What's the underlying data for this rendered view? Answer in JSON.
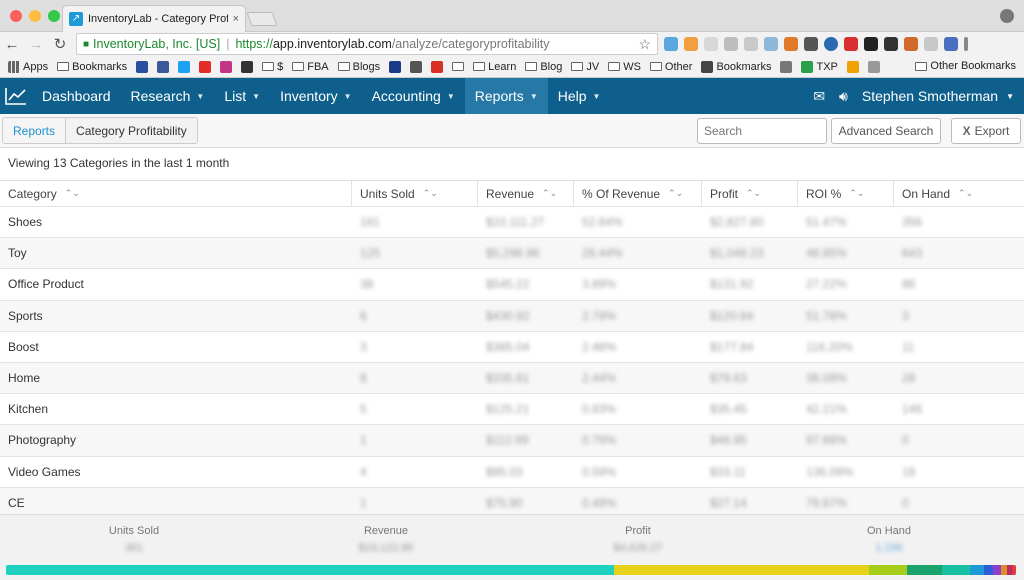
{
  "browser": {
    "tab_title": "InventoryLab - Category Profit",
    "tab_close": "×",
    "address": {
      "org": "InventoryLab, Inc. [US]",
      "scheme": "https://",
      "host": "app.inventorylab.com",
      "path": "/analyze/categoryprofitability"
    }
  },
  "bookmarks": [
    {
      "label": "Apps",
      "icon": "apps-grid-icon"
    },
    {
      "label": "Bookmarks",
      "icon": "folder-icon"
    },
    {
      "label": "",
      "icon": "m-icon"
    },
    {
      "label": "",
      "icon": "facebook-icon"
    },
    {
      "label": "",
      "icon": "twitter-icon"
    },
    {
      "label": "",
      "icon": "youtube-icon"
    },
    {
      "label": "",
      "icon": "instagram-icon"
    },
    {
      "label": "",
      "icon": "bag-icon"
    },
    {
      "label": "$",
      "icon": "folder-icon"
    },
    {
      "label": "FBA",
      "icon": "folder-icon"
    },
    {
      "label": "Blogs",
      "icon": "folder-icon"
    },
    {
      "label": "",
      "icon": "badge-icon"
    },
    {
      "label": "",
      "icon": "apple-icon"
    },
    {
      "label": "",
      "icon": "gmail-icon"
    },
    {
      "label": "",
      "icon": "folder-icon"
    },
    {
      "label": "Learn",
      "icon": "folder-icon"
    },
    {
      "label": "Blog",
      "icon": "folder-icon"
    },
    {
      "label": "JV",
      "icon": "folder-icon"
    },
    {
      "label": "WS",
      "icon": "folder-icon"
    },
    {
      "label": "Other",
      "icon": "folder-icon"
    },
    {
      "label": "Bookmarks",
      "icon": "star-icon"
    },
    {
      "label": "",
      "icon": "gear-icon"
    },
    {
      "label": "TXP",
      "icon": "drive-icon"
    },
    {
      "label": "",
      "icon": "bars-icon"
    },
    {
      "label": "",
      "icon": "seller-icon"
    }
  ],
  "other_bookmarks": "Other Bookmarks",
  "nav": {
    "items": [
      {
        "label": "Dashboard",
        "caret": false
      },
      {
        "label": "Research",
        "caret": true
      },
      {
        "label": "List",
        "caret": true
      },
      {
        "label": "Inventory",
        "caret": true
      },
      {
        "label": "Accounting",
        "caret": true
      },
      {
        "label": "Reports",
        "caret": true,
        "active": true
      },
      {
        "label": "Help",
        "caret": true
      }
    ],
    "user": "Stephen Smotherman"
  },
  "breadcrumb": {
    "root": "Reports",
    "current": "Category Profitability"
  },
  "search_placeholder": "Search",
  "advanced_search": "Advanced Search",
  "export": "Export",
  "viewing_text": "Viewing 13 Categories in the last 1 month",
  "table": {
    "columns": [
      "Category",
      "Units Sold",
      "Revenue",
      "% Of Revenue",
      "Profit",
      "ROI %",
      "On Hand"
    ],
    "rows": [
      [
        "Shoes",
        "161",
        "$10,111.27",
        "52.84%",
        "$2,827.80",
        "51.47%",
        "356"
      ],
      [
        "Toy",
        "125",
        "$5,298.96",
        "28.44%",
        "$1,048.23",
        "48.85%",
        "643"
      ],
      [
        "Office Product",
        "38",
        "$545.22",
        "3.89%",
        "$131.92",
        "27.22%",
        "86"
      ],
      [
        "Sports",
        "6",
        "$430.92",
        "2.79%",
        "$120.84",
        "51.78%",
        "3"
      ],
      [
        "Boost",
        "3",
        "$385.04",
        "2.48%",
        "$177.84",
        "116.20%",
        "11"
      ],
      [
        "Home",
        "8",
        "$335.81",
        "2.44%",
        "$79.63",
        "38.09%",
        "28"
      ],
      [
        "Kitchen",
        "5",
        "$125.21",
        "0.83%",
        "$35.45",
        "42.21%",
        "146"
      ],
      [
        "Photography",
        "1",
        "$112.99",
        "0.79%",
        "$48.95",
        "97.88%",
        "0"
      ],
      [
        "Video Games",
        "4",
        "$95.03",
        "0.59%",
        "$33.11",
        "136.09%",
        "18"
      ],
      [
        "CE",
        "1",
        "$75.90",
        "0.49%",
        "$27.14",
        "79.87%",
        "0"
      ]
    ]
  },
  "totals": {
    "units_label": "Units Sold",
    "units_value": "361",
    "revenue_label": "Revenue",
    "revenue_value": "$19,122.86",
    "profit_label": "Profit",
    "profit_value": "$4,626.27",
    "onhand_label": "On Hand",
    "onhand_value": "1,196"
  },
  "revenue_bar": [
    {
      "share": 0.607,
      "color": "#1ed1c1"
    },
    {
      "share": 0.255,
      "color": "#e7d21a"
    },
    {
      "share": 0.038,
      "color": "#a8cc1a"
    },
    {
      "share": 0.035,
      "color": "#1aa36a"
    },
    {
      "share": 0.028,
      "color": "#16c0a0"
    },
    {
      "share": 0.014,
      "color": "#1e9ad6"
    },
    {
      "share": 0.009,
      "color": "#2f5fd6"
    },
    {
      "share": 0.008,
      "color": "#8d3fc9"
    },
    {
      "share": 0.006,
      "color": "#e08a2a"
    },
    {
      "share": 0.005,
      "color": "#b62d5f"
    },
    {
      "share": 0.004,
      "color": "#e63a3a"
    }
  ]
}
